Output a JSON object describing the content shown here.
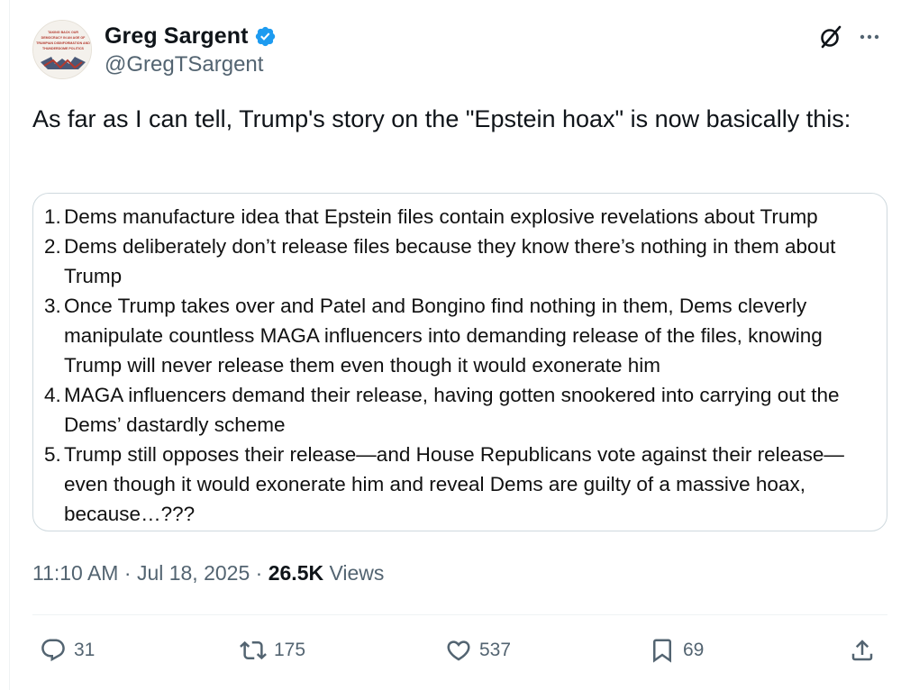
{
  "author": {
    "display_name": "Greg Sargent",
    "handle": "@GregTSargent",
    "verified": true,
    "avatar_text": "TAKING BACK OUR DEMOCRACY IN AN AGE OF TRUMPIAN DISINFORMATION AND THUNDERDOME POLITICS"
  },
  "tweet": {
    "text": "As far as I can tell, Trump's story on the \"Epstein hoax\" is now basically this:"
  },
  "media_list": [
    {
      "num": "1.",
      "text": "Dems manufacture idea that Epstein files contain explosive revelations about Trump"
    },
    {
      "num": "2.",
      "text": "Dems deliberately don’t release files because they know there’s nothing in them about Trump"
    },
    {
      "num": "3.",
      "text": "Once Trump takes over and Patel and Bongino find nothing in them, Dems cleverly manipulate countless MAGA influencers into demanding release of the files, knowing Trump will never release them even though it would exonerate him"
    },
    {
      "num": "4.",
      "text": "MAGA influencers demand their release, having gotten snookered into carrying out the Dems’ dastardly scheme"
    },
    {
      "num": "5.",
      "text": "Trump still opposes their release—and House Republicans vote against their release—even though it would exonerate him and reveal Dems are guilty of a massive hoax, because…???"
    }
  ],
  "meta": {
    "time": "11:10 AM",
    "sep1": " · ",
    "date": "Jul 18, 2025",
    "sep2": " · ",
    "views_count": "26.5K",
    "views_label": " Views"
  },
  "actions": {
    "replies": "31",
    "reposts": "175",
    "likes": "537",
    "bookmarks": "69"
  },
  "colors": {
    "text_primary": "#0f1419",
    "text_secondary": "#536471",
    "verified_blue": "#1d9bf0",
    "border": "#cfd9de"
  },
  "icons": [
    "grok-icon",
    "more-icon",
    "verified-badge-icon",
    "reply-icon",
    "repost-icon",
    "like-icon",
    "bookmark-icon",
    "share-icon"
  ]
}
